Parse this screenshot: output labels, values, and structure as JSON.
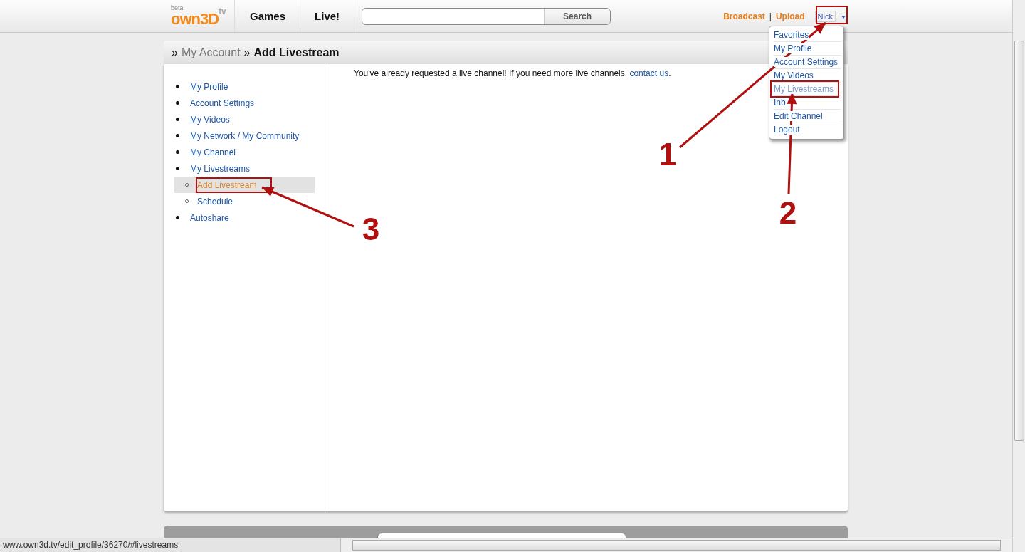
{
  "header": {
    "logo": {
      "badge": "beta",
      "name": "own3D",
      "suffix": "tv"
    },
    "nav": [
      {
        "label": "Games"
      },
      {
        "label": "Live!"
      }
    ],
    "search": {
      "button": "Search"
    },
    "links": [
      {
        "label": "Broadcast"
      },
      {
        "label": "Upload"
      }
    ],
    "separator": "|",
    "user_menu": {
      "label": "Nick",
      "expanded": true,
      "items": [
        {
          "label": "Favorites",
          "selected": false
        },
        {
          "label": "My Profile",
          "selected": false
        },
        {
          "label": "Account Settings",
          "selected": false
        },
        {
          "label": "My Videos",
          "selected": false
        },
        {
          "label": "My Livestreams",
          "selected": true
        },
        {
          "label": "Inb",
          "selected": false
        },
        {
          "label": "Edit Channel",
          "selected": false
        },
        {
          "label": "Logout",
          "selected": false
        }
      ]
    }
  },
  "breadcrumb": {
    "separators": [
      "»",
      "»"
    ],
    "parent": "My Account",
    "current": "Add Livestream"
  },
  "sidebar": {
    "items": [
      {
        "label": "My Profile",
        "selected": false
      },
      {
        "label": "Account Settings",
        "selected": false
      },
      {
        "label": "My Videos",
        "selected": false
      },
      {
        "label": "My Network / My Community",
        "selected": false
      },
      {
        "label": "My Channel",
        "selected": false
      },
      {
        "label": "My Livestreams",
        "selected": false,
        "children": [
          {
            "label": "Add Livestream",
            "selected": true
          },
          {
            "label": "Schedule",
            "selected": false
          }
        ]
      },
      {
        "label": "Autoshare",
        "selected": false
      }
    ]
  },
  "message": {
    "before": "You've already requested a live channel! If you need more live channels, ",
    "link": "contact us",
    "after": "."
  },
  "annotations": [
    {
      "label": "1"
    },
    {
      "label": "2"
    },
    {
      "label": "3"
    }
  ],
  "status_bar": {
    "url": "www.own3d.tv/edit_profile/36270/#livestreams"
  }
}
